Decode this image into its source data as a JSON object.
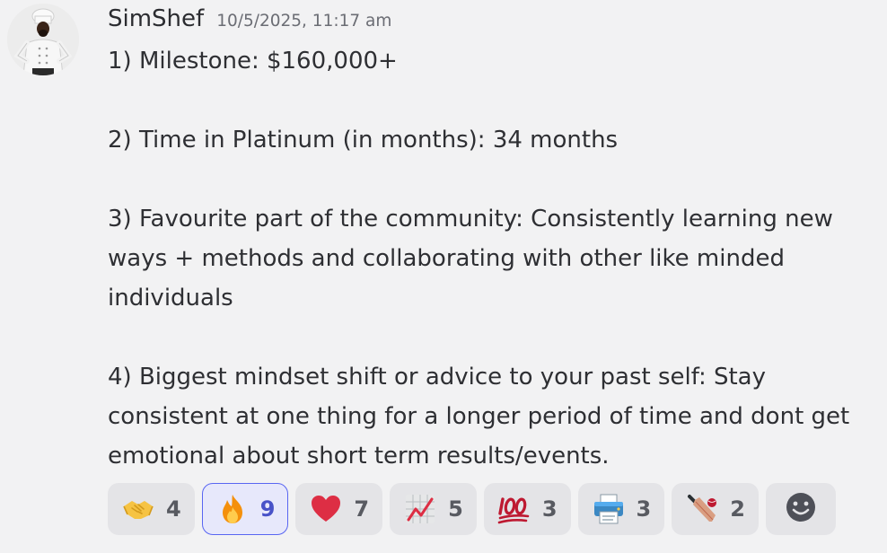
{
  "message": {
    "username": "SimShef",
    "timestamp": "10/5/2025, 11:17 am",
    "lines": [
      "1) Milestone: $160,000+",
      "",
      "2) Time in Platinum (in months): 34 months",
      "",
      "3) Favourite part of the community: Consistently learning new",
      "ways + methods and collaborating with other like minded",
      "individuals",
      "",
      "4) Biggest mindset shift or advice to your past self: Stay",
      "consistent at one thing for a longer period of time and dont get",
      "emotional about short term results/events."
    ]
  },
  "reactions": [
    {
      "emoji": "handshake-emoji",
      "count": "4",
      "active": false
    },
    {
      "emoji": "fire-emoji",
      "count": "9",
      "active": true
    },
    {
      "emoji": "red-heart-emoji",
      "count": "7",
      "active": false
    },
    {
      "emoji": "chart-increasing-emoji",
      "count": "5",
      "active": false
    },
    {
      "emoji": "hundred-points-emoji",
      "count": "3",
      "active": false
    },
    {
      "emoji": "printer-emoji",
      "count": "3",
      "active": false
    },
    {
      "emoji": "cricket-bat-emoji",
      "count": "2",
      "active": false
    }
  ],
  "add_reaction": {
    "icon": "smiley-face-icon"
  },
  "colors": {
    "background": "#f2f2f3",
    "reaction_bg": "#e4e4e7",
    "active_border": "#5865f2",
    "active_bg": "#e7e8fb"
  }
}
